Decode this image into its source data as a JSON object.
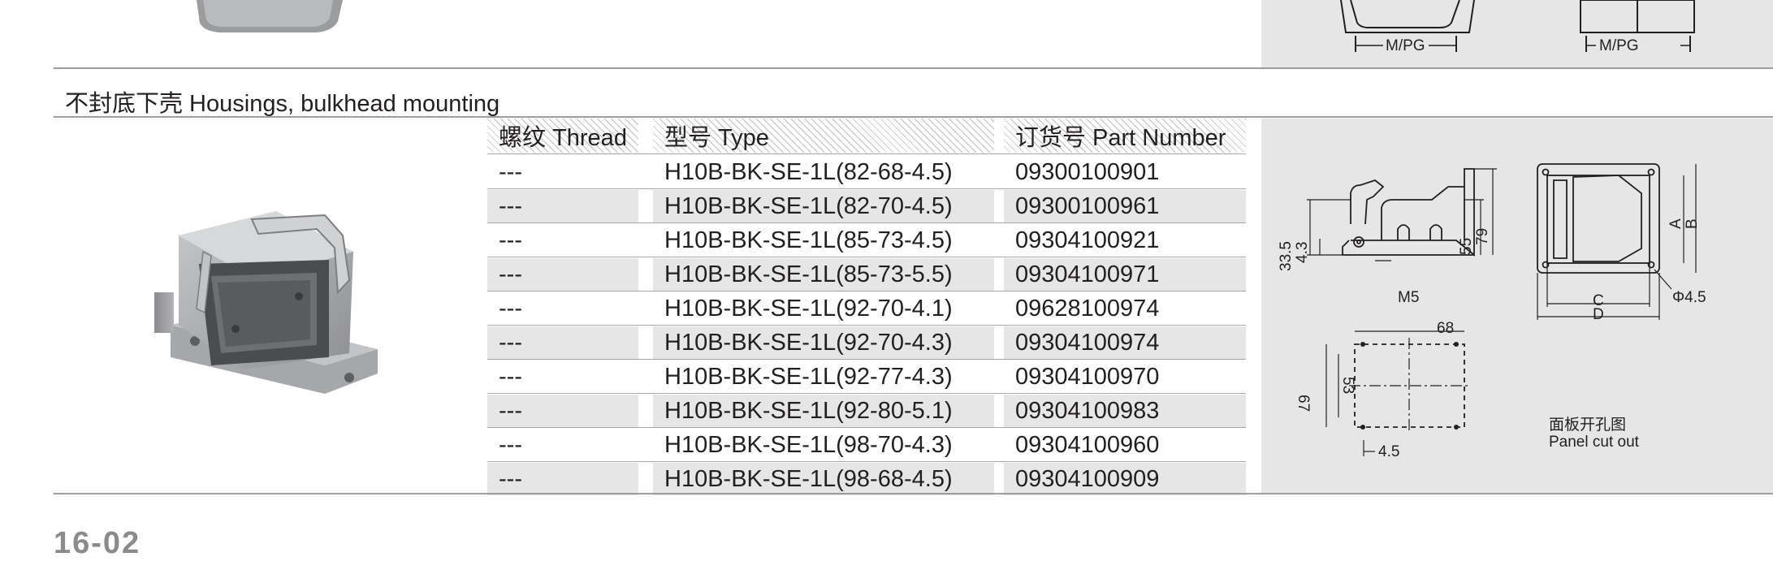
{
  "top": {
    "labels": [
      "M/PG",
      "M/PG"
    ]
  },
  "section": {
    "title": "不封底下壳 Housings, bulkhead mounting"
  },
  "table": {
    "headers": {
      "thread": "螺纹 Thread",
      "type": "型号 Type",
      "part_number": "订货号 Part Number"
    },
    "rows": [
      {
        "thread": "---",
        "type": "H10B-BK-SE-1L(82-68-4.5)",
        "part_number": "09300100901"
      },
      {
        "thread": "---",
        "type": "H10B-BK-SE-1L(82-70-4.5)",
        "part_number": "09300100961"
      },
      {
        "thread": "---",
        "type": "H10B-BK-SE-1L(85-73-4.5)",
        "part_number": "09304100921"
      },
      {
        "thread": "---",
        "type": "H10B-BK-SE-1L(85-73-5.5)",
        "part_number": "09304100971"
      },
      {
        "thread": "---",
        "type": "H10B-BK-SE-1L(92-70-4.1)",
        "part_number": "09628100974"
      },
      {
        "thread": "---",
        "type": "H10B-BK-SE-1L(92-70-4.3)",
        "part_number": "09304100974"
      },
      {
        "thread": "---",
        "type": "H10B-BK-SE-1L(92-77-4.3)",
        "part_number": "09304100970"
      },
      {
        "thread": "---",
        "type": "H10B-BK-SE-1L(92-80-5.1)",
        "part_number": "09304100983"
      },
      {
        "thread": "---",
        "type": "H10B-BK-SE-1L(98-70-4.3)",
        "part_number": "09304100960"
      },
      {
        "thread": "---",
        "type": "H10B-BK-SE-1L(98-68-4.5)",
        "part_number": "09304100909"
      }
    ]
  },
  "drawing": {
    "side": {
      "d1": "33.5",
      "d2": "4.3",
      "d3": "55",
      "d4": "79",
      "d5": "M5"
    },
    "front": {
      "a": "A",
      "b": "B",
      "c": "C",
      "d": "D",
      "hole": "Φ4.5"
    },
    "cutout": {
      "w": "68",
      "h1": "67",
      "h2": "53",
      "hole": "4.5",
      "caption_cn": "面板开孔图",
      "caption_en": "Panel cut out"
    }
  },
  "footer": {
    "page_number": "16-02"
  }
}
